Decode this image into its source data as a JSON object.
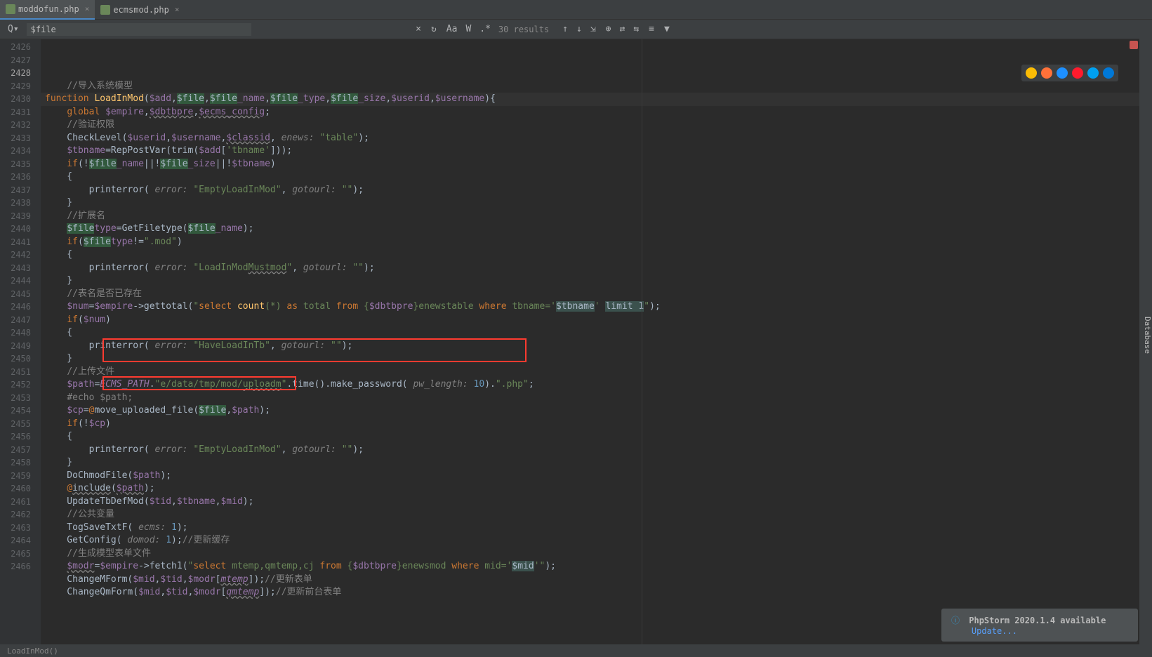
{
  "tabs": [
    {
      "label": "moddofun.php",
      "active": true
    },
    {
      "label": "ecmsmod.php",
      "active": false
    }
  ],
  "search": {
    "icon": "Q▾",
    "value": "$file",
    "results": "30 results"
  },
  "gutter_start": 2426,
  "gutter_end": 2466,
  "current_line": 2428,
  "code_lines": [
    {
      "n": 2426,
      "html": ""
    },
    {
      "n": 2427,
      "html": "    <span class='c-comment'>//导入系统模型</span>"
    },
    {
      "n": 2428,
      "html": "<span class='c-kw'>function</span> <span class='c-fn'>LoadInMod</span>(<span class='c-var'>$add</span>,<span class='hl'>$file</span>,<span class='hl'>$file</span><span class='c-var'>_name</span>,<span class='hl'>$file</span><span class='c-var'>_type</span>,<span class='hl'>$file</span><span class='c-var'>_size</span>,<span class='c-var'>$userid</span>,<span class='c-var'>$username</span>){"
    },
    {
      "n": 2429,
      "html": "    <span class='c-kw'>global</span> <span class='c-var'>$empire</span>,<span class='c-var wavy'>$dbtbpre</span>,<span class='c-var wavy'>$ecms_config</span>;"
    },
    {
      "n": 2430,
      "html": "    <span class='c-comment'>//验证权限</span>"
    },
    {
      "n": 2431,
      "html": "    CheckLevel(<span class='c-var'>$userid</span>,<span class='c-var'>$username</span>,<span class='c-var wavy'>$classid</span>, <span class='c-param'>enews:</span> <span class='c-str'>\"table\"</span>);"
    },
    {
      "n": 2432,
      "html": "    <span class='c-var'>$tbname</span>=RepPostVar(trim(<span class='c-var'>$add</span>[<span class='c-str'>'tbname'</span>]));"
    },
    {
      "n": 2433,
      "html": "    <span class='c-kw'>if</span>(!<span class='hl'>$file</span><span class='c-var'>_name</span>||!<span class='hl'>$file</span><span class='c-var'>_size</span>||!<span class='c-var'>$tbname</span>)"
    },
    {
      "n": 2434,
      "html": "    {"
    },
    {
      "n": 2435,
      "html": "        printerror( <span class='c-param'>error:</span> <span class='c-str'>\"EmptyLoadInMod\"</span>, <span class='c-param'>gotourl:</span> <span class='c-str'>\"\"</span>);"
    },
    {
      "n": 2436,
      "html": "    }"
    },
    {
      "n": 2437,
      "html": "    <span class='c-comment'>//扩展名</span>"
    },
    {
      "n": 2438,
      "html": "    <span class='hl'>$file</span><span class='c-var'>type</span>=GetFiletype(<span class='hl'>$file</span><span class='c-var'>_name</span>);"
    },
    {
      "n": 2439,
      "html": "    <span class='c-kw'>if</span>(<span class='hl'>$file</span><span class='c-var'>type</span>!=<span class='c-str'>\".mod\"</span>)"
    },
    {
      "n": 2440,
      "html": "    {"
    },
    {
      "n": 2441,
      "html": "        printerror( <span class='c-param'>error:</span> <span class='c-str'>\"LoadInMod<span class='wavy'>Mustmod</span>\"</span>, <span class='c-param'>gotourl:</span> <span class='c-str'>\"\"</span>);"
    },
    {
      "n": 2442,
      "html": "    }"
    },
    {
      "n": 2443,
      "html": "    <span class='c-comment'>//表名是否已存在</span>"
    },
    {
      "n": 2444,
      "html": "    <span class='c-var'>$num</span>=<span class='c-var'>$empire</span>-&gt;gettotal(<span class='c-str'>\"</span><span class='c-kw'>select</span> <span class='c-fn'>count</span><span class='c-str'>(*)</span> <span class='c-kw'>as</span> <span class='c-str'>total</span> <span class='c-kw'>from</span> <span class='c-str'>{</span><span class='c-var'>$dbtbpre</span><span class='c-str'>}enewstable</span> <span class='c-kw'>where</span> <span class='c-str'>tbname='</span><span class='hl2'>$tbname</span><span class='c-str'>'</span> <span class='hl2'>limit 1</span><span class='c-str'>\"</span>);"
    },
    {
      "n": 2445,
      "html": "    <span class='c-kw'>if</span>(<span class='c-var'>$num</span>)"
    },
    {
      "n": 2446,
      "html": "    {"
    },
    {
      "n": 2447,
      "html": "        printerror( <span class='c-param'>error:</span> <span class='c-str'>\"HaveLoadInTb\"</span>, <span class='c-param'>gotourl:</span> <span class='c-str'>\"\"</span>);"
    },
    {
      "n": 2448,
      "html": "    }"
    },
    {
      "n": 2449,
      "html": "    <span class='c-comment'>//上传文件</span>"
    },
    {
      "n": 2450,
      "html": "    <span class='c-var'>$path</span>=<span class='c-const'>ECMS_PATH</span>.<span class='c-str'>\"e/data/tmp/mod/<span class='wavy'>uploadm</span>\"</span>.time().make_password( <span class='c-param'>pw_length:</span> <span class='c-num'>10</span>).<span class='c-str'>\".php\"</span>;"
    },
    {
      "n": 2451,
      "html": "    <span class='c-comment'>#echo $path;</span>"
    },
    {
      "n": 2452,
      "html": "    <span class='c-var'>$cp</span>=<span class='c-kw'>@</span>move_uploaded_file(<span class='hl'>$file</span>,<span class='c-var'>$path</span>);"
    },
    {
      "n": 2453,
      "html": "    <span class='c-kw'>if</span>(!<span class='c-var'>$cp</span>)"
    },
    {
      "n": 2454,
      "html": "    {"
    },
    {
      "n": 2455,
      "html": "        printerror( <span class='c-param'>error:</span> <span class='c-str'>\"EmptyLoadInMod\"</span>, <span class='c-param'>gotourl:</span> <span class='c-str'>\"\"</span>);"
    },
    {
      "n": 2456,
      "html": "    }"
    },
    {
      "n": 2457,
      "html": "    DoChmodFile(<span class='c-var'>$path</span>);"
    },
    {
      "n": 2458,
      "html": "    <span class='c-kw'>@</span><span class='wavy'>include</span>(<span class='c-var wavy'>$path</span>);"
    },
    {
      "n": 2459,
      "html": "    UpdateTbDefMod(<span class='c-var'>$tid</span>,<span class='c-var'>$tbname</span>,<span class='c-var'>$mid</span>);"
    },
    {
      "n": 2460,
      "html": "    <span class='c-comment'>//公共变量</span>"
    },
    {
      "n": 2461,
      "html": "    TogSaveTxtF( <span class='c-param'>ecms:</span> <span class='c-num'>1</span>);"
    },
    {
      "n": 2462,
      "html": "    GetConfig( <span class='c-param'>domod:</span> <span class='c-num'>1</span>);<span class='c-comment'>//更新缓存</span>"
    },
    {
      "n": 2463,
      "html": "    <span class='c-comment'>//生成模型表单文件</span>"
    },
    {
      "n": 2464,
      "html": "    <span class='c-var wavy'>$modr</span>=<span class='c-var'>$empire</span>-&gt;fetch1(<span class='c-str'>\"</span><span class='c-kw'>select</span> <span class='c-str'>mtemp,qmtemp,cj</span> <span class='c-kw'>from</span> <span class='c-str'>{</span><span class='c-var'>$dbtbpre</span><span class='c-str'>}enewsmod</span> <span class='c-kw'>where</span> <span class='c-str'>mid='</span><span class='hl2'>$mid</span><span class='c-str'>'\"</span>);"
    },
    {
      "n": 2465,
      "html": "    ChangeMForm(<span class='c-var'>$mid</span>,<span class='c-var'>$tid</span>,<span class='c-var'>$modr</span>[<span class='c-const wavy'>mtemp</span>]);<span class='c-comment'>//更新表单</span>"
    },
    {
      "n": 2466,
      "html": "    ChangeQmForm(<span class='c-var'>$mid</span>,<span class='c-var'>$tid</span>,<span class='c-var'>$modr</span>[<span class='c-const wavy'>qmtemp</span>]);<span class='c-comment'>//更新前台表单</span>"
    }
  ],
  "status": {
    "breadcrumb": "LoadInMod()"
  },
  "notification": {
    "title": "PhpStorm 2020.1.4 available",
    "link": "Update..."
  },
  "sidepanel": {
    "label": "Database"
  },
  "browsers": [
    "chrome",
    "firefox",
    "safari",
    "opera",
    "ie",
    "edge"
  ],
  "browser_colors": {
    "chrome": "#fbbc05",
    "firefox": "#ff7139",
    "safari": "#1e90ff",
    "opera": "#ff1b2d",
    "ie": "#00a1f1",
    "edge": "#0078d7"
  }
}
